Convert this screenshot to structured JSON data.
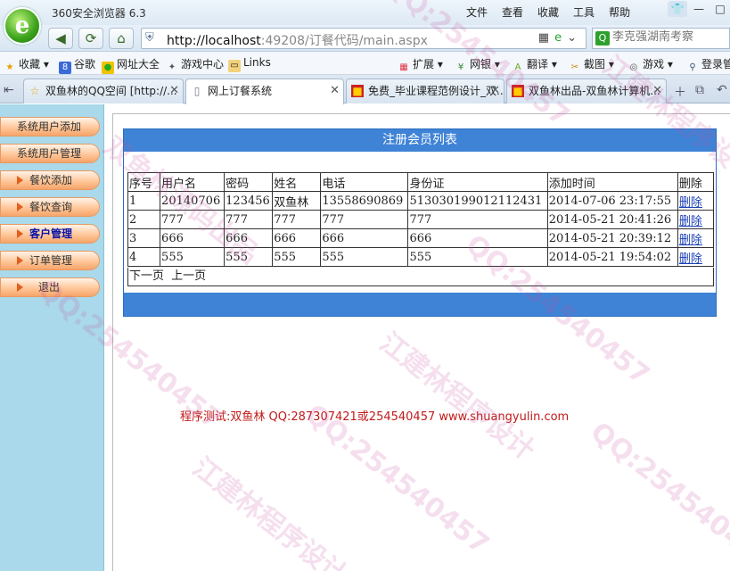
{
  "browser": {
    "app_title": "360安全浏览器 6.3",
    "menu": [
      "文件",
      "查看",
      "收藏",
      "工具",
      "帮助"
    ],
    "url_host": "http://localhost",
    "url_rest": ":49208/订餐代码/main.aspx",
    "search_placeholder": "李克强湖南考察",
    "bookmarks": [
      "收藏",
      "谷歌",
      "网址大全",
      "游戏中心",
      "Links"
    ],
    "toolbar_right": [
      "扩展",
      "网银",
      "翻译",
      "截图",
      "游戏",
      "登录管"
    ],
    "tabs": [
      {
        "label": "双鱼林的QQ空间 [http://..."
      },
      {
        "label": "网上订餐系统"
      },
      {
        "label": "免费_毕业课程范例设计_双..."
      },
      {
        "label": "双鱼林出品-双鱼林计算机..."
      }
    ]
  },
  "sidebar": {
    "items": [
      {
        "label": "系统用户添加"
      },
      {
        "label": "系统用户管理"
      },
      {
        "label": "餐饮添加"
      },
      {
        "label": "餐饮查询"
      },
      {
        "label": "客户管理"
      },
      {
        "label": "订单管理"
      },
      {
        "label": "退出"
      }
    ]
  },
  "panel": {
    "title": "注册会员列表",
    "columns": [
      "序号",
      "用户名",
      "密码",
      "姓名",
      "电话",
      "身份证",
      "添加时间",
      "删除"
    ],
    "rows": [
      [
        "1",
        "20140706",
        "123456",
        "双鱼林",
        "13558690869",
        "513030199012112431",
        "2014-07-06 23:17:55",
        "删除"
      ],
      [
        "2",
        "777",
        "777",
        "777",
        "777",
        "777",
        "2014-05-21 20:41:26",
        "删除"
      ],
      [
        "3",
        "666",
        "666",
        "666",
        "666",
        "666",
        "2014-05-21 20:39:12",
        "删除"
      ],
      [
        "4",
        "555",
        "555",
        "555",
        "555",
        "555",
        "2014-05-21 19:54:02",
        "删除"
      ]
    ],
    "pager": {
      "next": "下一页",
      "prev": "上一页"
    }
  },
  "credit": "程序测试:双鱼林 QQ:287307421或254540457 www.shuangyulin.com",
  "watermarks": [
    "QQ:254540457",
    "江建林程序设计",
    "双鱼林源码出品"
  ],
  "colors": {
    "panel_header": "#3f83d6",
    "sidebar_bg": "#a9d9ea",
    "credit": "#c21a1a",
    "link": "#1a3fb8"
  }
}
